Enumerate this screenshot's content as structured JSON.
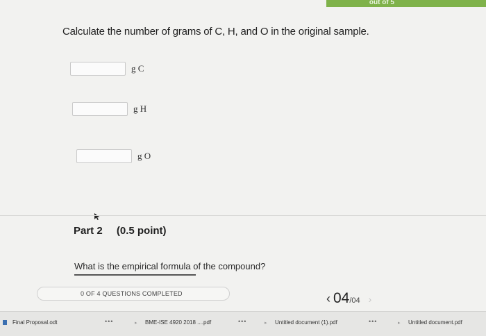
{
  "header": {
    "score_badge": "out of 5",
    "accent_color": "#7fb24a"
  },
  "question": {
    "text": "Calculate the number of grams of C, H, and O in the original sample.",
    "answers": [
      {
        "unit": "g C",
        "value": ""
      },
      {
        "unit": "g H",
        "value": ""
      },
      {
        "unit": "g O",
        "value": ""
      }
    ]
  },
  "part2": {
    "title": "Part 2",
    "points": "(0.5 point)",
    "question": "What is the empirical formula of the compound?"
  },
  "footer": {
    "progress_label": "0 OF 4 QUESTIONS COMPLETED",
    "progress_fraction": 0,
    "pager_prev": "‹",
    "pager_current": "04",
    "pager_total": "/04",
    "pager_next": "›"
  },
  "downloads": [
    {
      "name": "Final Proposal.odt",
      "icon": "document-icon"
    },
    {
      "name": "BME-ISE 4920 2018 ....pdf",
      "icon": "pdf-icon"
    },
    {
      "name": "Untitled document (1).pdf",
      "icon": "pdf-icon"
    },
    {
      "name": "Untitled document.pdf",
      "icon": "pdf-icon"
    }
  ],
  "more_glyph": "•••"
}
